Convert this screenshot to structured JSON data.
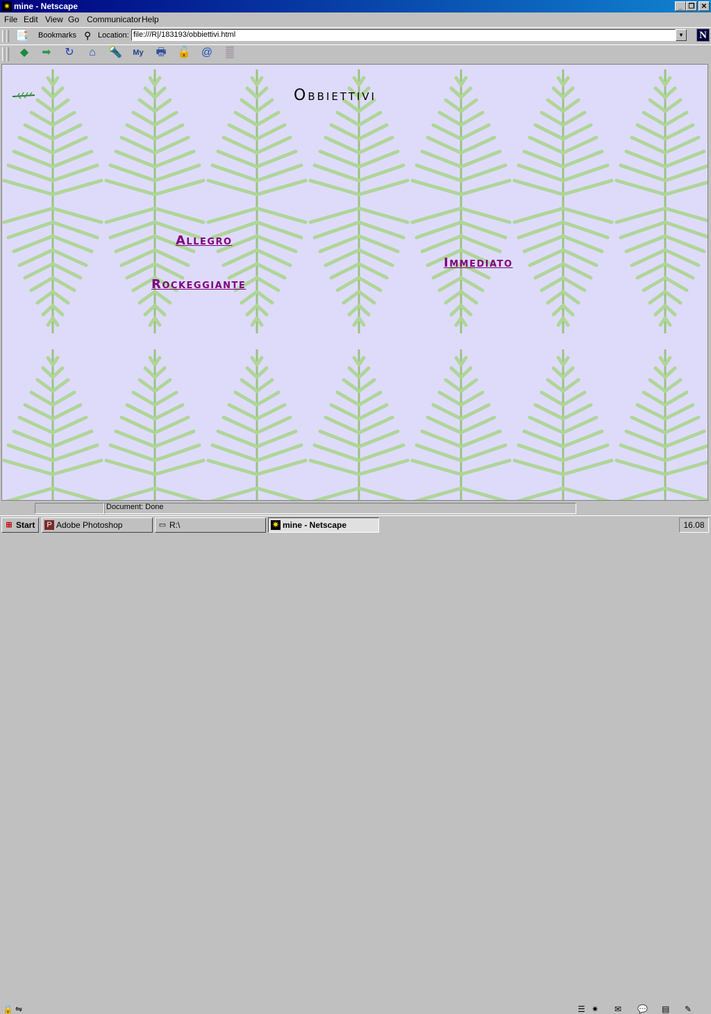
{
  "window": {
    "title": "mine - Netscape",
    "icon": "netscape-icon",
    "controls": [
      "minimize",
      "restore",
      "close"
    ]
  },
  "menu": {
    "items": [
      "File",
      "Edit",
      "View",
      "Go",
      "Communicator",
      "Help"
    ]
  },
  "location_bar": {
    "bookmarks_label": "Bookmarks",
    "location_label": "Location:",
    "url": "file:///R|/183193/obbiettivi.html",
    "logo_letter": "N"
  },
  "toolbar": {
    "buttons": [
      "back-icon",
      "forward-icon",
      "reload-icon",
      "home-icon",
      "search-icon",
      "my-netscape-icon",
      "print-icon",
      "security-icon",
      "shop-icon",
      "stop-icon"
    ]
  },
  "page": {
    "title": "Obbiettivi",
    "links": {
      "allegro": "Allegro",
      "rockeggiante": "Rockeggiante",
      "immediato": "Immediato"
    },
    "background_color": "#dedbfa",
    "link_color": "#800080"
  },
  "status": {
    "text": "Document: Done"
  },
  "taskbar": {
    "start": "Start",
    "tasks": [
      {
        "label": "Adobe Photoshop",
        "active": false
      },
      {
        "label": "R:\\",
        "active": false
      },
      {
        "label": "mine - Netscape",
        "active": true
      }
    ],
    "clock": "16.08"
  }
}
